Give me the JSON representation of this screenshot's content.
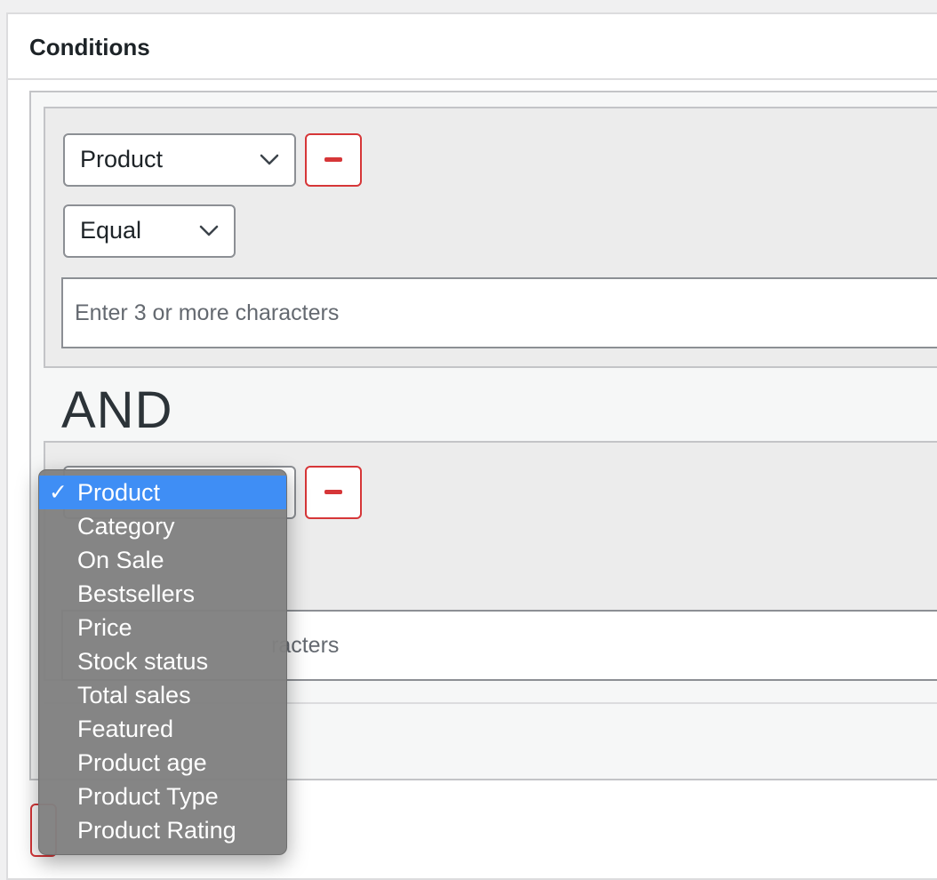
{
  "panel": {
    "title": "Conditions"
  },
  "conditions": [
    {
      "field_value": "Product",
      "operator_value": "Equal",
      "input_placeholder": "Enter 3 or more characters"
    },
    {
      "field_value": "Product",
      "input_placeholder_visible": "racters"
    }
  ],
  "connector": "AND",
  "dropdown": {
    "selected": "Product",
    "check_mark": "✓",
    "options": [
      "Product",
      "Category",
      "On Sale",
      "Bestsellers",
      "Price",
      "Stock status",
      "Total sales",
      "Featured",
      "Product age",
      "Product Type",
      "Product Rating"
    ]
  },
  "colors": {
    "accent_red": "#d63638",
    "selected_blue": "#3f8ef5",
    "menu_gray": "#808080"
  },
  "icons": {
    "chevron": "chevron-down-icon",
    "remove": "minus-icon",
    "check": "checkmark-icon"
  }
}
